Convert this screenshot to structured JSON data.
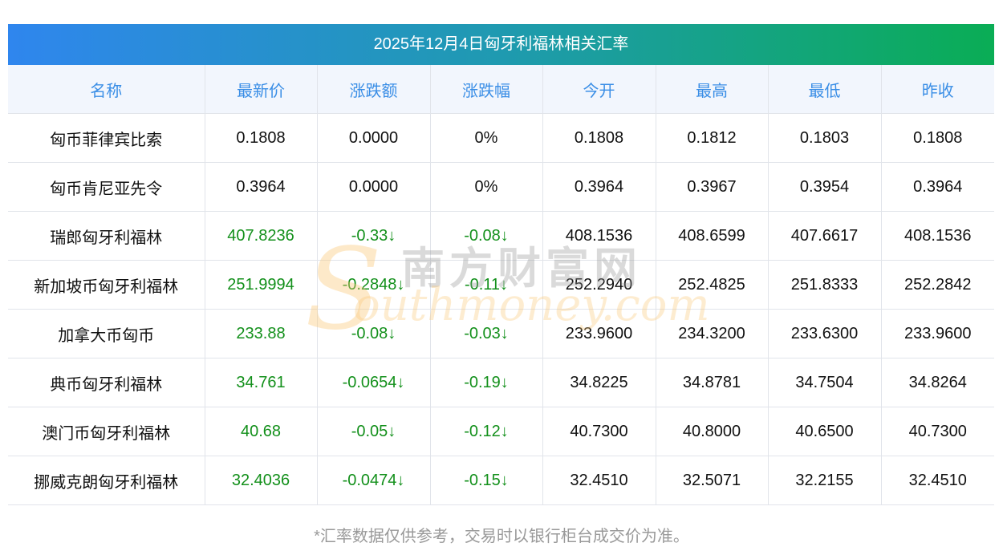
{
  "title": "2025年12月4日匈牙利福林相关汇率",
  "headers": [
    "名称",
    "最新价",
    "涨跌额",
    "涨跌幅",
    "今开",
    "最高",
    "最低",
    "昨收"
  ],
  "rows": [
    [
      "匈币菲律宾比索",
      "0.1808",
      "0.0000",
      "0%",
      "0.1808",
      "0.1812",
      "0.1803",
      "0.1808"
    ],
    [
      "匈币肯尼亚先令",
      "0.3964",
      "0.0000",
      "0%",
      "0.3964",
      "0.3967",
      "0.3954",
      "0.3964"
    ],
    [
      "瑞郎匈牙利福林",
      "407.8236",
      "-0.33↓",
      "-0.08↓",
      "408.1536",
      "408.6599",
      "407.6617",
      "408.1536"
    ],
    [
      "新加坡币匈牙利福林",
      "251.9994",
      "-0.2848↓",
      "-0.11↓",
      "252.2940",
      "252.4825",
      "251.8333",
      "252.2842"
    ],
    [
      "加拿大币匈币",
      "233.88",
      "-0.08↓",
      "-0.03↓",
      "233.9600",
      "234.3200",
      "233.6300",
      "233.9600"
    ],
    [
      "典币匈牙利福林",
      "34.761",
      "-0.0654↓",
      "-0.19↓",
      "34.8225",
      "34.8781",
      "34.7504",
      "34.8264"
    ],
    [
      "澳门币匈牙利福林",
      "40.68",
      "-0.05↓",
      "-0.12↓",
      "40.7300",
      "40.8000",
      "40.6500",
      "40.7300"
    ],
    [
      "挪威克朗匈牙利福林",
      "32.4036",
      "-0.0474↓",
      "-0.15↓",
      "32.4510",
      "32.5071",
      "32.2155",
      "32.4510"
    ]
  ],
  "down_rows": [
    2,
    3,
    4,
    5,
    6,
    7
  ],
  "footer": "*汇率数据仅供参考，交易时以银行柜台成交价为准。",
  "watermark": {
    "cn": "南方财富网",
    "en": "outhmoney.com",
    "s": "S"
  },
  "colors": {
    "header_text": "#3a8ee6",
    "down": "#13901b",
    "title_start": "#2f86ee",
    "title_end": "#0aad55"
  }
}
